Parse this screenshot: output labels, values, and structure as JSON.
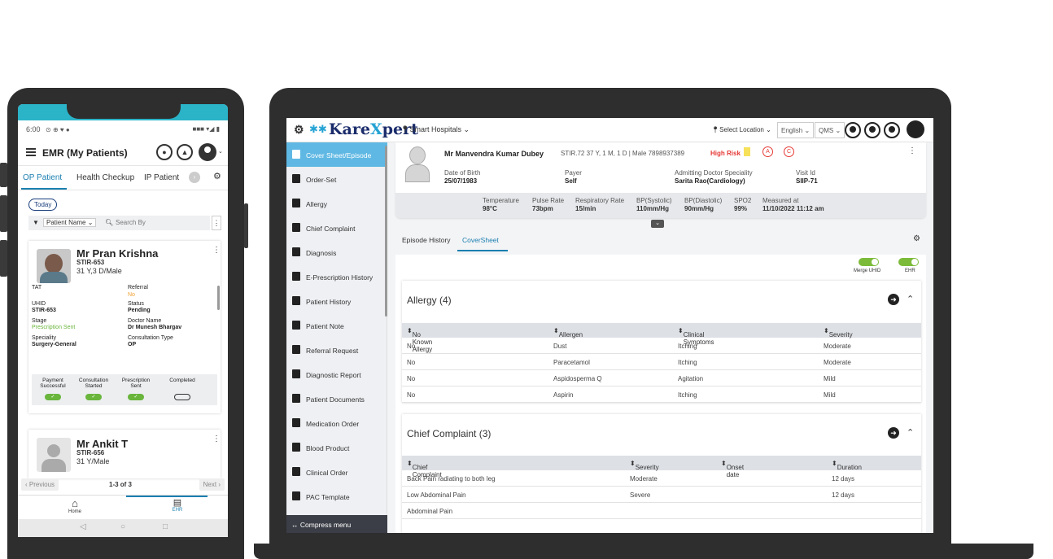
{
  "phone": {
    "status_time": "6:00",
    "status_right": "■■■ ▾◢ ▮",
    "header_title": "EMR (My Patients)",
    "tabs": [
      "OP Patient",
      "Health Checkup",
      "IP Patient"
    ],
    "today": "Today",
    "filter_option": "Patient Name",
    "search_placeholder": "Search By",
    "patients": [
      {
        "name": "Mr Pran Krishna",
        "id": "STIR-653",
        "age": "31 Y,3 D/Male",
        "fields": {
          "tat_label": "TAT",
          "referral_label": "Referral",
          "referral_value": "No",
          "uhid_label": "UHID",
          "uhid_value": "STIR-653",
          "status_label": "Status",
          "status_value": "Pending",
          "stage_label": "Stage",
          "stage_value": "Prescription Sent",
          "doctor_label": "Doctor Name",
          "doctor_value": "Dr Munesh Bhargav",
          "speciality_label": "Speciality",
          "speciality_value": "Surgery-General",
          "consult_label": "Consultation Type",
          "consult_value": "OP"
        },
        "steps": [
          "Payment Successful",
          "Consultation Started",
          "Prescription Sent",
          "Completed"
        ]
      },
      {
        "name": "Mr Ankit T",
        "id": "STIR-656",
        "age": "31 Y/Male"
      }
    ],
    "pager": {
      "prev": "‹ Previous",
      "count": "1-3 of 3",
      "next": "Next ›"
    },
    "nav": {
      "home": "Home",
      "ehr": "EHR"
    }
  },
  "laptop": {
    "logo_a": "Kare",
    "logo_x": "X",
    "logo_b": "pert",
    "hospital": "Smart Hospitals",
    "select_location": "Select Location",
    "language": "English",
    "qms": "QMS",
    "sidebar": [
      "Cover Sheet/Episode",
      "Order-Set",
      "Allergy",
      "Chief Complaint",
      "Diagnosis",
      "E-Prescription History",
      "Patient History",
      "Patient Note",
      "Referral Request",
      "Diagnostic Report",
      "Patient Documents",
      "Medication Order",
      "Blood Product",
      "Clinical Order",
      "PAC Template"
    ],
    "compress": "Compress menu",
    "patient": {
      "name": "Mr Manvendra Kumar Dubey",
      "meta": "STIR.72  37 Y, 1 M, 1 D | Male   7898937389",
      "risk": "High Risk",
      "badge_a": "A",
      "badge_c": "C",
      "dob_label": "Date of Birth",
      "dob": "25/07/1983",
      "payer_label": "Payer",
      "payer": "Self",
      "doctor_label": "Admitting Doctor Speciality",
      "doctor": "Sarita Rao(Cardiology)",
      "visit_label": "Visit Id",
      "visit": "SIIP-71"
    },
    "vitals": [
      {
        "label": "Temperature",
        "value": "98°C"
      },
      {
        "label": "Pulse Rate",
        "value": "73bpm"
      },
      {
        "label": "Respiratory Rate",
        "value": "15/min"
      },
      {
        "label": "BP(Systolic)",
        "value": "110mm/Hg"
      },
      {
        "label": "BP(Diastolic)",
        "value": "90mm/Hg"
      },
      {
        "label": "SPO2",
        "value": "99%"
      },
      {
        "label": "Measured at",
        "value": "11/10/2022 11:12 am"
      }
    ],
    "tabs": [
      "Episode History",
      "CoverSheet"
    ],
    "toggles": [
      "Merge UHID",
      "EHR"
    ],
    "allergy": {
      "title": "Allergy (4)",
      "headers": [
        "No Known Allergy",
        "Allergen",
        "Clinical Symptoms",
        "Severity"
      ],
      "rows": [
        [
          "No",
          "Dust",
          "Itching",
          "Moderate"
        ],
        [
          "No",
          "Paracetamol",
          "Itching",
          "Moderate"
        ],
        [
          "No",
          "Aspidosperma Q",
          "Agitation",
          "Mild"
        ],
        [
          "No",
          "Aspirin",
          "Itching",
          "Mild"
        ]
      ]
    },
    "complaint": {
      "title": "Chief Complaint (3)",
      "headers": [
        "Chief Complaint",
        "Severity",
        "Onset date",
        "Duration"
      ],
      "rows": [
        [
          "Back Pain radiating to both leg",
          "Moderate",
          "",
          "12 days"
        ],
        [
          "Low Abdominal Pain",
          "Severe",
          "",
          "12 days"
        ],
        [
          "Abdominal Pain",
          "",
          "",
          ""
        ]
      ]
    }
  }
}
